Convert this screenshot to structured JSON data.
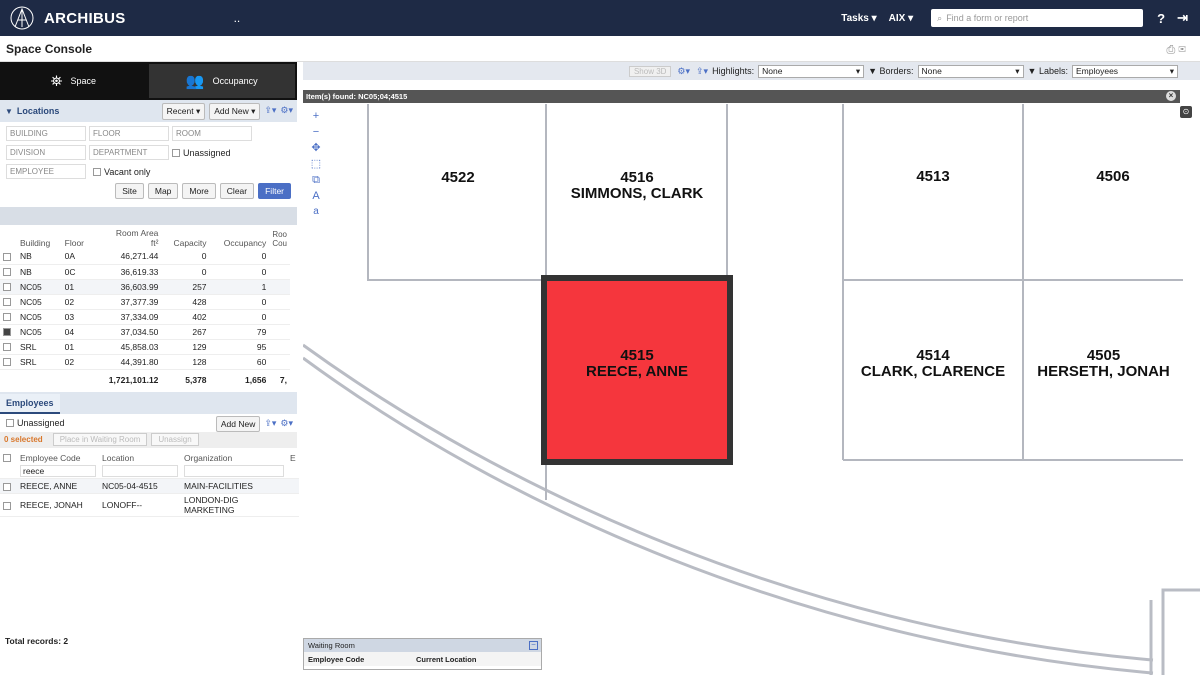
{
  "app": {
    "brand": "ARCHIBUS",
    "dots": "..",
    "menu_tasks": "Tasks ▾",
    "menu_user": "AIX ▾",
    "search_placeholder": "Find a form or report",
    "help_glyph": "?",
    "logout_glyph": "⇥"
  },
  "console": {
    "title": "Space Console",
    "icons": "⎙ ✉"
  },
  "modes": [
    {
      "label": "Space",
      "glyph": "⛯"
    },
    {
      "label": "Occupancy",
      "glyph": "👥"
    }
  ],
  "locations": {
    "title": "Locations",
    "recent": "Recent ▾",
    "add_new": "Add New ▾",
    "export_glyph": "⇪▾",
    "settings_glyph": "⚙▾",
    "fields": {
      "building": "BUILDING",
      "floor": "FLOOR",
      "room": "ROOM",
      "division": "DIVISION",
      "department": "DEPARTMENT",
      "employee": "EMPLOYEE"
    },
    "unassigned": "Unassigned",
    "vacant_only": "Vacant only",
    "buttons": {
      "site": "Site",
      "map": "Map",
      "more": "More",
      "clear": "Clear",
      "filter": "Filter"
    }
  },
  "floors_table": {
    "headers": {
      "building": "Building",
      "floor": "Floor",
      "room_area": "Room Area",
      "area_unit": "ft²",
      "capacity": "Capacity",
      "occupancy": "Occupancy",
      "room_count": "Roo Cou"
    },
    "rows": [
      {
        "building": "NB",
        "floor": "0A",
        "area": "46,271.44",
        "capacity": "0",
        "occupancy": "0",
        "checked": false
      },
      {
        "building": "NB",
        "floor": "0C",
        "area": "36,619.33",
        "capacity": "0",
        "occupancy": "0",
        "checked": false
      },
      {
        "building": "NC05",
        "floor": "01",
        "area": "36,603.99",
        "capacity": "257",
        "occupancy": "1",
        "checked": false
      },
      {
        "building": "NC05",
        "floor": "02",
        "area": "37,377.39",
        "capacity": "428",
        "occupancy": "0",
        "checked": false
      },
      {
        "building": "NC05",
        "floor": "03",
        "area": "37,334.09",
        "capacity": "402",
        "occupancy": "0",
        "checked": false
      },
      {
        "building": "NC05",
        "floor": "04",
        "area": "37,034.50",
        "capacity": "267",
        "occupancy": "79",
        "checked": true
      },
      {
        "building": "SRL",
        "floor": "01",
        "area": "45,858.03",
        "capacity": "129",
        "occupancy": "95",
        "checked": false
      },
      {
        "building": "SRL",
        "floor": "02",
        "area": "44,391.80",
        "capacity": "128",
        "occupancy": "60",
        "checked": false
      }
    ],
    "totals": {
      "area": "1,721,101.12",
      "capacity": "5,378",
      "occupancy": "1,656",
      "room_count": "7,"
    }
  },
  "employees": {
    "tab": "Employees",
    "unassigned": "Unassigned",
    "add_new": "Add New",
    "export_glyph": "⇪▾",
    "settings_glyph": "⚙▾",
    "selected": "0 selected",
    "place_waiting": "Place in Waiting Room",
    "unassign": "Unassign",
    "headers": {
      "code": "Employee Code",
      "location": "Location",
      "organization": "Organization",
      "extra": "E"
    },
    "filter_value": "reece",
    "rows": [
      {
        "code": "REECE, ANNE",
        "location": "NC05-04-4515",
        "organization": "MAIN-FACILITIES"
      },
      {
        "code": "REECE, JONAH",
        "location": "LONOFF--",
        "organization": "LONDON-DIG MARKETING"
      }
    ],
    "total_records": "Total records: 2"
  },
  "map": {
    "disabled_btn": "Show 3D",
    "highlights_label": "Highlights:",
    "highlights_value": "None",
    "borders_label": "Borders:",
    "borders_value": "None",
    "labels_label": "Labels:",
    "labels_value": "Employees",
    "found": "Item(s) found: NC05;04;4515",
    "highlight_color": "#f5363d",
    "rooms": [
      {
        "number": "4522",
        "occupant": ""
      },
      {
        "number": "4516",
        "occupant": "SIMMONS, CLARK"
      },
      {
        "number": "4513",
        "occupant": ""
      },
      {
        "number": "4506",
        "occupant": ""
      },
      {
        "number": "4515",
        "occupant": "REECE, ANNE"
      },
      {
        "number": "4514",
        "occupant": "CLARK, CLARENCE"
      },
      {
        "number": "4505",
        "occupant": "HERSETH, JONAH"
      }
    ]
  },
  "waiting_room": {
    "title": "Waiting Room",
    "col_code": "Employee Code",
    "col_location": "Current Location"
  }
}
